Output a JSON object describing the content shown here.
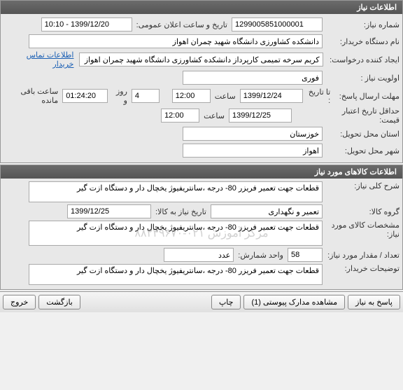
{
  "section1": {
    "title": "اطلاعات نیاز",
    "request_no_label": "شماره نیاز:",
    "request_no": "1299005851000001",
    "datetime_label": "تاریخ و ساعت اعلان عمومی:",
    "datetime": "10:10 - 1399/12/20",
    "buyer_label": "نام دستگاه خریدار:",
    "buyer": "دانشکده کشاورزی دانشگاه شهید چمران اهواز",
    "creator_label": "ایجاد کننده درخواست:",
    "creator": "کریم سرخه تمیمی کارپرداز دانشکده کشاورزی دانشگاه شهید چمران اهواز",
    "contact_link": "اطلاعات تماس خریدار",
    "priority_label": "اولویت نیاز :",
    "priority": "فوری",
    "deadline_label": "مهلت ارسال پاسخ:",
    "deadline_until": "تا تاریخ :",
    "deadline_date": "1399/12/24",
    "deadline_hour": "ساعت",
    "deadline_time": "12:00",
    "days_label": "روز و",
    "days": "4",
    "remain_time": "01:24:20",
    "remain_label": "ساعت باقی مانده",
    "validity_label": "حداقل تاریخ اعتبار قیمت:",
    "validity_date": "1399/12/25",
    "validity_hour": "ساعت",
    "validity_time": "12:00",
    "province_label": "استان محل تحویل:",
    "province": "خوزستان",
    "city_label": "شهر محل تحویل:",
    "city": "اهواز"
  },
  "section2": {
    "title": "اطلاعات کالاهای مورد نیاز",
    "general_label": "شرح کلی نیاز:",
    "general_desc": "قطعات جهت تعمیر فریزر 80- درجه ،سانتریفیوژ یخچال دار و دستگاه ازت گیر",
    "group_label": "گروه کالا:",
    "group": "تعمیر و نگهداری",
    "need_date_label": "تاریخ نیاز به کالا:",
    "need_date": "1399/12/25",
    "spec_label": "مشخصات کالای مورد نیاز:",
    "spec": "قطعات جهت تعمیر فریزر 80- درجه ،سانتریفیوژ یخچال دار و دستگاه ازت گیر",
    "watermark": "مرکز آموزش ۰۲۱-۸۸۲۴۹۶۷۰",
    "qty_label": "تعداد / مقدار مورد نیاز:",
    "qty": "58",
    "unit_label": "واحد شمارش:",
    "unit": "عدد",
    "notes_label": "توضیحات خریدار:",
    "notes": "قطعات جهت تعمیر فریزر 80- درجه ،سانتریفیوژ یخچال دار و دستگاه ازت گیر"
  },
  "footer": {
    "reply": "پاسخ به نیاز",
    "attachments": "مشاهده مدارک پیوستی (1)",
    "print": "چاپ",
    "back": "بازگشت",
    "exit": "خروج"
  }
}
